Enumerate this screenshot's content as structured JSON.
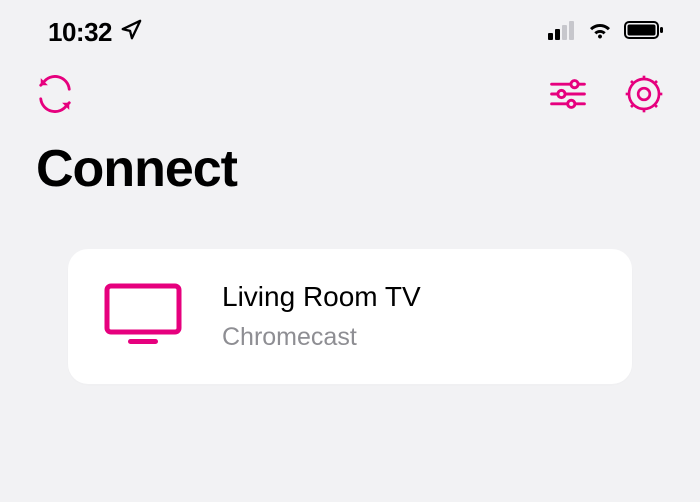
{
  "status_bar": {
    "time": "10:32"
  },
  "page": {
    "title": "Connect"
  },
  "colors": {
    "accent": "#e6007e"
  },
  "devices": [
    {
      "name": "Living Room TV",
      "type": "Chromecast"
    }
  ]
}
